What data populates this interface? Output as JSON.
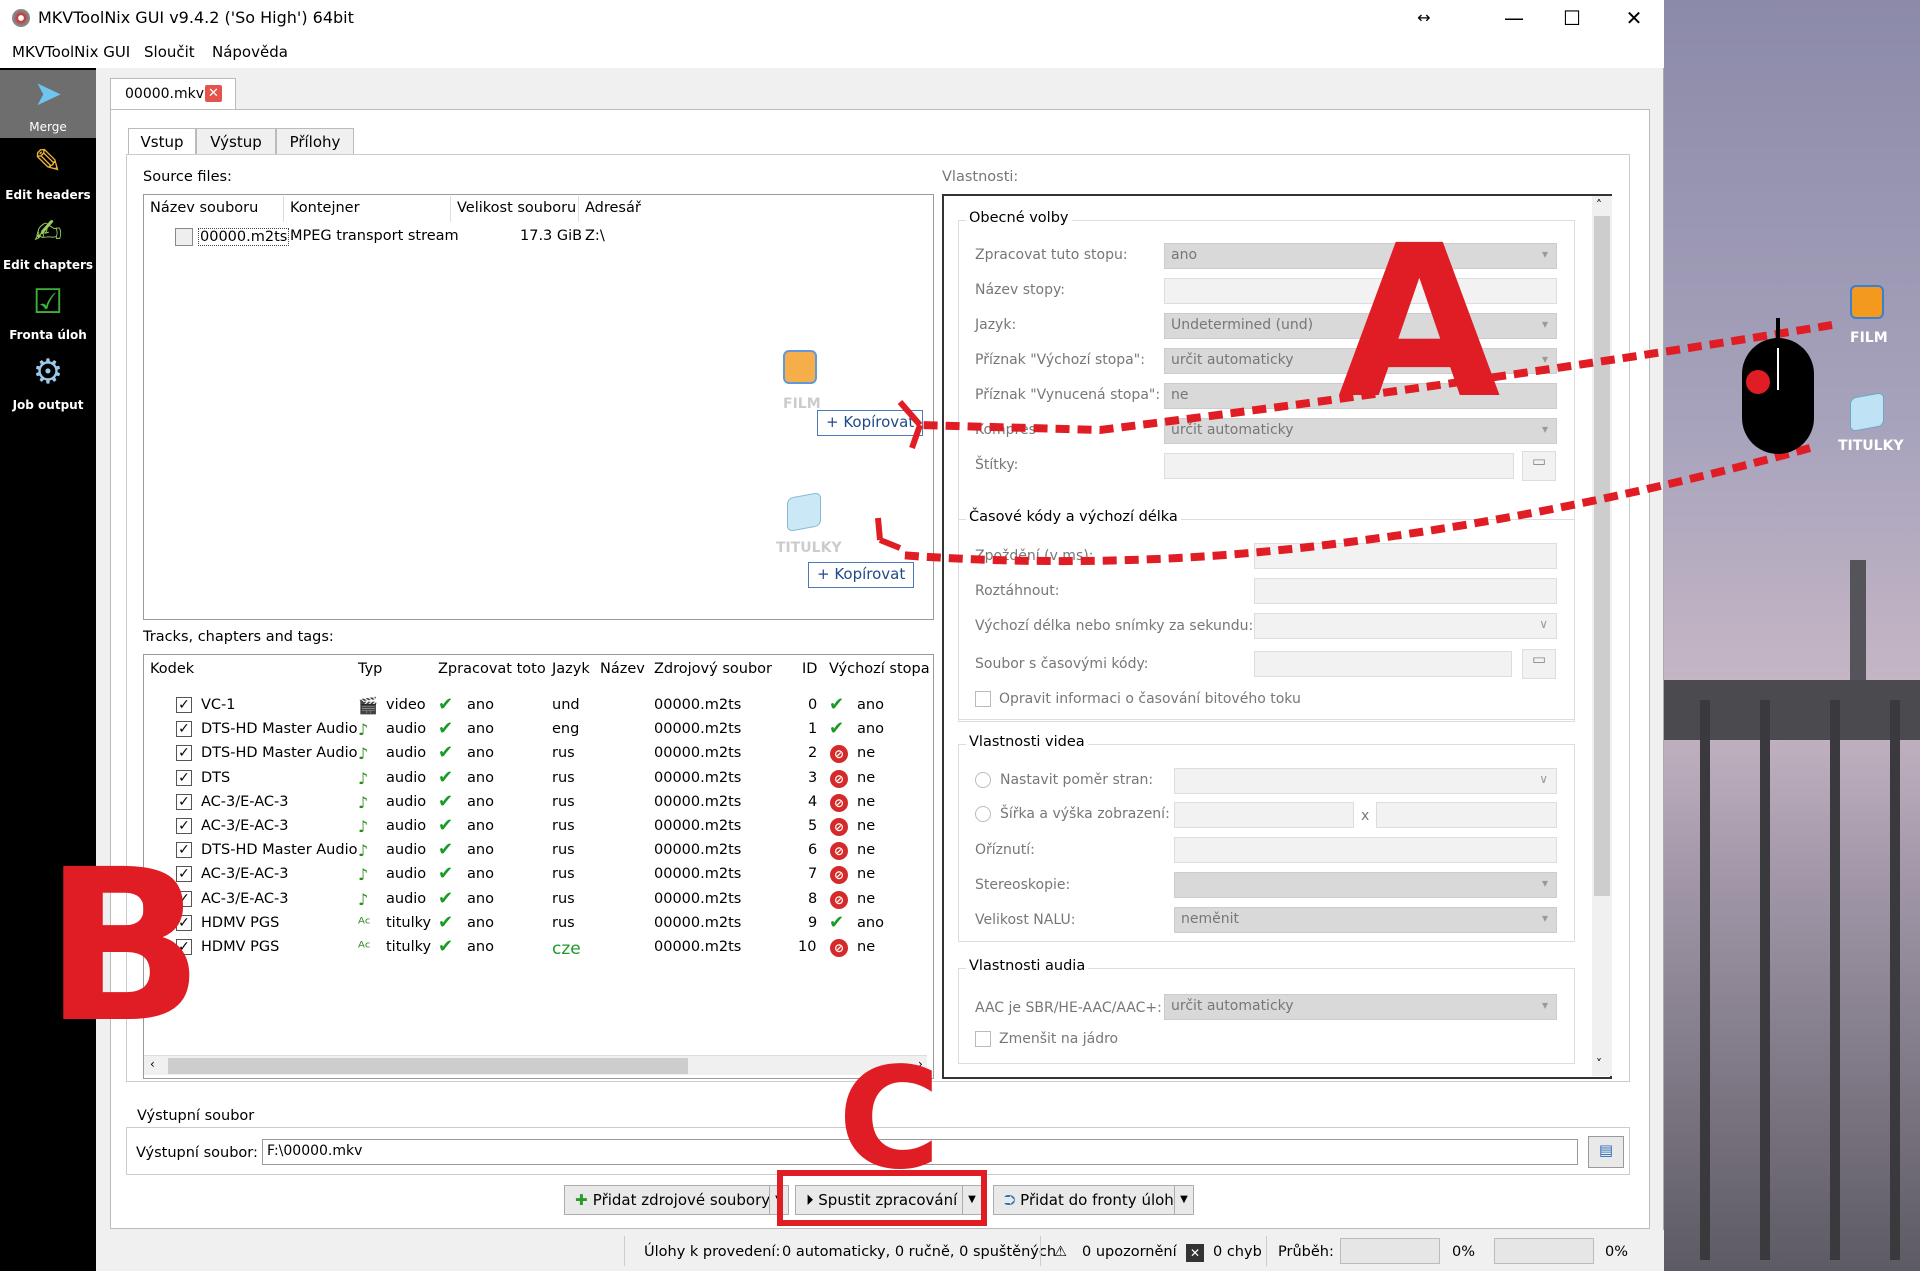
{
  "window": {
    "title": "MKVToolNix GUI v9.4.2 ('So High') 64bit"
  },
  "menu": [
    "MKVToolNix GUI",
    "Sloučit",
    "Nápověda"
  ],
  "sidebar": [
    {
      "label": "Merge",
      "icon": "merge-icon"
    },
    {
      "label": "Edit headers",
      "icon": "pencil-icon"
    },
    {
      "label": "Edit chapters",
      "icon": "notepad-icon"
    },
    {
      "label": "Fronta úloh",
      "icon": "checklist-icon"
    },
    {
      "label": "Job output",
      "icon": "gear-icon"
    }
  ],
  "doc_tab": "00000.mkv",
  "sub_tabs": [
    "Vstup",
    "Výstup",
    "Přílohy"
  ],
  "source_files": {
    "label": "Source files:",
    "columns": [
      "Název souboru",
      "Kontejner",
      "Velikost souboru",
      "Adresář"
    ],
    "rows": [
      {
        "name": "00000.m2ts",
        "container": "MPEG transport stream",
        "size": "17.3 GiB",
        "dir": "Z:\\"
      }
    ]
  },
  "overlay": {
    "film_label": "FILM",
    "titulky_label": "TITULKY",
    "copy_label": "+ Kopírovat",
    "letters": [
      "A",
      "B",
      "C"
    ]
  },
  "tracks": {
    "label": "Tracks, chapters and tags:",
    "columns": [
      "Kodek",
      "Typ",
      "Zpracovat toto",
      "Jazyk",
      "Název",
      "Zdrojový soubor",
      "ID",
      "Výchozí stopa v"
    ],
    "rows": [
      {
        "codec": "VC-1",
        "type": "video",
        "process": "ano",
        "lang": "und",
        "source": "00000.m2ts",
        "id": "0",
        "default": "ano",
        "def_ok": true
      },
      {
        "codec": "DTS-HD Master Audio",
        "type": "audio",
        "process": "ano",
        "lang": "eng",
        "source": "00000.m2ts",
        "id": "1",
        "default": "ano",
        "def_ok": true
      },
      {
        "codec": "DTS-HD Master Audio",
        "type": "audio",
        "process": "ano",
        "lang": "rus",
        "source": "00000.m2ts",
        "id": "2",
        "default": "ne",
        "def_ok": false
      },
      {
        "codec": "DTS",
        "type": "audio",
        "process": "ano",
        "lang": "rus",
        "source": "00000.m2ts",
        "id": "3",
        "default": "ne",
        "def_ok": false
      },
      {
        "codec": "AC-3/E-AC-3",
        "type": "audio",
        "process": "ano",
        "lang": "rus",
        "source": "00000.m2ts",
        "id": "4",
        "default": "ne",
        "def_ok": false
      },
      {
        "codec": "AC-3/E-AC-3",
        "type": "audio",
        "process": "ano",
        "lang": "rus",
        "source": "00000.m2ts",
        "id": "5",
        "default": "ne",
        "def_ok": false
      },
      {
        "codec": "DTS-HD Master Audio",
        "type": "audio",
        "process": "ano",
        "lang": "rus",
        "source": "00000.m2ts",
        "id": "6",
        "default": "ne",
        "def_ok": false
      },
      {
        "codec": "AC-3/E-AC-3",
        "type": "audio",
        "process": "ano",
        "lang": "rus",
        "source": "00000.m2ts",
        "id": "7",
        "default": "ne",
        "def_ok": false
      },
      {
        "codec": "AC-3/E-AC-3",
        "type": "audio",
        "process": "ano",
        "lang": "rus",
        "source": "00000.m2ts",
        "id": "8",
        "default": "ne",
        "def_ok": false
      },
      {
        "codec": "HDMV PGS",
        "type": "titulky",
        "process": "ano",
        "lang": "rus",
        "source": "00000.m2ts",
        "id": "9",
        "default": "ano",
        "def_ok": true
      },
      {
        "codec": "HDMV PGS",
        "type": "titulky",
        "process": "ano",
        "lang": "cze",
        "source": "00000.m2ts",
        "id": "10",
        "default": "ne",
        "def_ok": false
      }
    ]
  },
  "properties": {
    "label": "Vlastnosti:",
    "general": {
      "title": "Obecné volby",
      "fields": [
        {
          "label": "Zpracovat tuto stopu:",
          "value": "ano"
        },
        {
          "label": "Název stopy:",
          "value": ""
        },
        {
          "label": "Jazyk:",
          "value": "Undetermined (und)"
        },
        {
          "label": "Příznak \"Výchozí stopa\":",
          "value": "určit automaticky"
        },
        {
          "label": "Příznak \"Vynucená stopa\":",
          "value": "ne"
        },
        {
          "label": "Kompres",
          "value": "určit automaticky"
        },
        {
          "label": "Štítky:",
          "value": ""
        }
      ]
    },
    "timecodes": {
      "title": "Časové kódy a výchozí délka",
      "fields": [
        "Zpoždění (v ms):",
        "Roztáhnout:",
        "Výchozí délka nebo snímky za sekundu:",
        "Soubor s časovými kódy:"
      ],
      "checkbox": "Opravit informaci o časování bitového toku"
    },
    "video": {
      "title": "Vlastnosti videa",
      "fields": [
        "Nastavit poměr stran:",
        "Šířka a výška zobrazení:",
        "Oříznutí:",
        "Stereoskopie:",
        "Velikost NALU:"
      ],
      "x_sep": "x",
      "nalu_value": "neměnit"
    },
    "audio": {
      "title": "Vlastnosti audia",
      "field": "AAC je SBR/HE-AAC/AAC+:",
      "value": "určit automaticky",
      "checkbox": "Zmenšit na jádro"
    }
  },
  "output": {
    "group_title": "Výstupní soubor",
    "label": "Výstupní soubor:",
    "value": "F:\\00000.mkv"
  },
  "buttons": {
    "add_sources": "Přidat zdrojové soubory",
    "start": "Spustit zpracování",
    "add_queue": "Přidat do fronty úloh"
  },
  "status": {
    "jobs": "Úlohy k provedení:",
    "jobs_value": "0 automaticky, 0 ručně, 0 spuštěných",
    "warnings": "0 upozornění",
    "errors": "0 chyb",
    "progress_label": "Průběh:",
    "progress1": "0%",
    "progress2": "0%"
  },
  "desktop": {
    "icons": [
      "FILM",
      "TITULKY"
    ]
  },
  "colors": {
    "annotation_red": "#e01d25",
    "check_green": "#1a9a27",
    "no_red": "#d52a2a"
  }
}
